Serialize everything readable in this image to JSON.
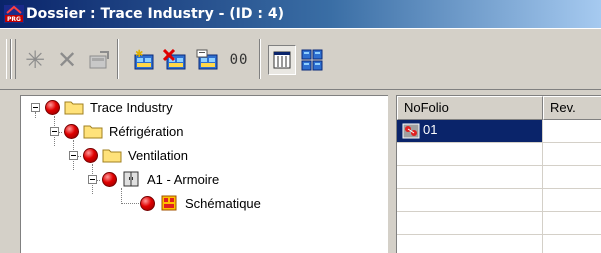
{
  "window": {
    "title": "Dossier : Trace Industry - (ID : 4)",
    "app_icon": "prg-app-icon",
    "app_icon_text": "PRG"
  },
  "toolbar": {
    "buttons": [
      {
        "name": "new-star-icon",
        "enabled": false
      },
      {
        "name": "delete-x-icon",
        "enabled": false
      },
      {
        "name": "properties-icon",
        "enabled": false
      },
      {
        "name": "add-component-icon",
        "enabled": true
      },
      {
        "name": "remove-component-icon",
        "enabled": true
      },
      {
        "name": "edit-component-icon",
        "enabled": true
      },
      {
        "name": "view-oo-icon",
        "enabled": true,
        "glyph": "00"
      },
      {
        "name": "list-view-icon",
        "enabled": true,
        "pressed": true
      },
      {
        "name": "grid-view-icon",
        "enabled": true
      }
    ]
  },
  "tree": {
    "nodes": [
      {
        "label": "Trace Industry",
        "level": 0,
        "icon": "folder-icon",
        "status": "red",
        "expanded": true
      },
      {
        "label": "Réfrigération",
        "level": 1,
        "icon": "folder-icon",
        "status": "red",
        "expanded": true
      },
      {
        "label": "Ventilation",
        "level": 2,
        "icon": "folder-icon",
        "status": "red",
        "expanded": true
      },
      {
        "label": "A1 - Armoire",
        "level": 3,
        "icon": "cabinet-icon",
        "status": "red",
        "expanded": true
      },
      {
        "label": "Schématique",
        "level": 4,
        "icon": "schematic-icon",
        "status": "red",
        "expanded": false
      }
    ]
  },
  "grid": {
    "columns": [
      "NoFolio",
      "Rev."
    ],
    "rows": [
      {
        "nofolio": "01",
        "rev": "",
        "selected": true,
        "icon": "folio-icon"
      }
    ],
    "colors": {
      "selection": "#0a246a",
      "selection_text": "#ffffff"
    }
  },
  "colors": {
    "face": "#d4d0c8",
    "title_start": "#0a246a",
    "title_end": "#a6caf0",
    "status_red": "#e00000"
  }
}
